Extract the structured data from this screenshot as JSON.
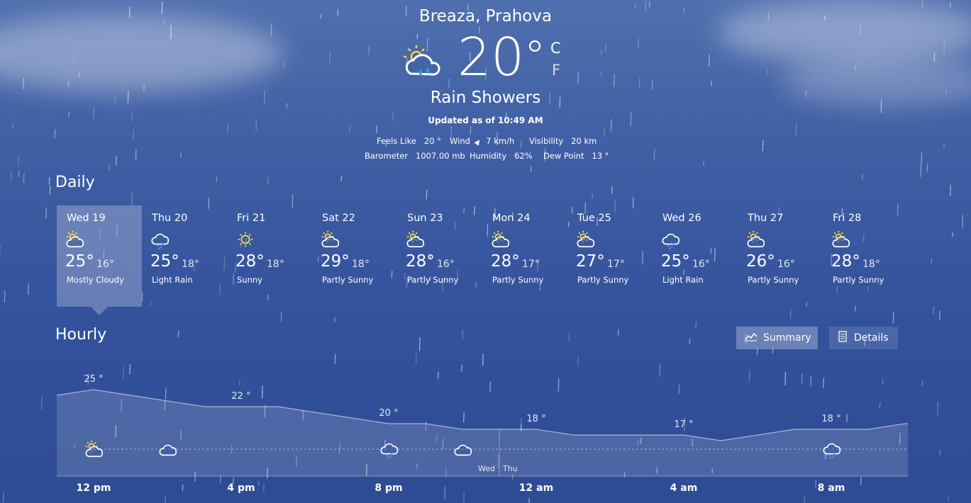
{
  "current": {
    "location": "Breaza, Prahova",
    "temperature": "20",
    "degree": "°",
    "unit_c": "C",
    "unit_f": "F",
    "condition": "Rain Showers",
    "updated": "Updated as of 10:49 AM",
    "icon": "sun-rain-cloud-icon",
    "details": {
      "feels_like_label": "Feels Like",
      "feels_like": "20 °",
      "wind_label": "Wind",
      "wind": "7 km/h",
      "visibility_label": "Visibility",
      "visibility": "20 km",
      "barometer_label": "Barometer",
      "barometer": "1007.00 mb",
      "humidity_label": "Humidity",
      "humidity": "62%",
      "dew_point_label": "Dew Point",
      "dew_point": "13 °"
    }
  },
  "daily": {
    "title": "Daily",
    "days": [
      {
        "name": "Wed 19",
        "hi": "25°",
        "lo": "16°",
        "cond": "Mostly Cloudy",
        "icon": "partly-cloudy"
      },
      {
        "name": "Thu 20",
        "hi": "25°",
        "lo": "18°",
        "cond": "Light Rain",
        "icon": "rain"
      },
      {
        "name": "Fri 21",
        "hi": "28°",
        "lo": "18°",
        "cond": "Sunny",
        "icon": "sunny"
      },
      {
        "name": "Sat 22",
        "hi": "29°",
        "lo": "18°",
        "cond": "Partly Sunny",
        "icon": "partly-cloudy"
      },
      {
        "name": "Sun 23",
        "hi": "28°",
        "lo": "16°",
        "cond": "Partly Sunny",
        "icon": "partly-cloudy"
      },
      {
        "name": "Mon 24",
        "hi": "28°",
        "lo": "17°",
        "cond": "Partly Sunny",
        "icon": "partly-cloudy"
      },
      {
        "name": "Tue 25",
        "hi": "27°",
        "lo": "17°",
        "cond": "Partly Sunny",
        "icon": "partly-cloudy"
      },
      {
        "name": "Wed 26",
        "hi": "25°",
        "lo": "16°",
        "cond": "Light Rain",
        "icon": "rain"
      },
      {
        "name": "Thu 27",
        "hi": "26°",
        "lo": "16°",
        "cond": "Partly Sunny",
        "icon": "partly-cloudy"
      },
      {
        "name": "Fri 28",
        "hi": "28°",
        "lo": "18°",
        "cond": "Partly Sunny",
        "icon": "partly-cloudy"
      }
    ]
  },
  "hourly": {
    "title": "Hourly",
    "summary_label": "Summary",
    "details_label": "Details",
    "day_boundary": {
      "left": "Wed",
      "right": "Thu",
      "hour": 12
    },
    "time_labels": [
      {
        "hour": 0,
        "label": "12 pm"
      },
      {
        "hour": 4,
        "label": "4 pm"
      },
      {
        "hour": 8,
        "label": "8 pm"
      },
      {
        "hour": 12,
        "label": "12 am"
      },
      {
        "hour": 16,
        "label": "4 am"
      },
      {
        "hour": 20,
        "label": "8 am"
      }
    ],
    "icons": [
      {
        "hour": 0,
        "icon": "partly-cloudy"
      },
      {
        "hour": 2,
        "icon": "cloudy"
      },
      {
        "hour": 8,
        "icon": "rain"
      },
      {
        "hour": 10,
        "icon": "cloudy"
      },
      {
        "hour": 20,
        "icon": "rain"
      }
    ]
  },
  "chart_data": {
    "type": "area",
    "hours_from_12pm": [
      0,
      1,
      2,
      3,
      4,
      5,
      6,
      7,
      8,
      9,
      10,
      11,
      12,
      13,
      14,
      15,
      16,
      17,
      18,
      19,
      20,
      21,
      22,
      23
    ],
    "temperatures": [
      24,
      25,
      24,
      23,
      22,
      22,
      22,
      21,
      20,
      19,
      19,
      18,
      18,
      18,
      17,
      17,
      17,
      17,
      16,
      17,
      18,
      18,
      18,
      19
    ],
    "labels": [
      {
        "hour": 1,
        "text": "25 °"
      },
      {
        "hour": 5,
        "text": "22 °"
      },
      {
        "hour": 9,
        "text": "20 °"
      },
      {
        "hour": 13,
        "text": "18 °"
      },
      {
        "hour": 17,
        "text": "17 °"
      },
      {
        "hour": 21,
        "text": "18 °"
      }
    ]
  }
}
